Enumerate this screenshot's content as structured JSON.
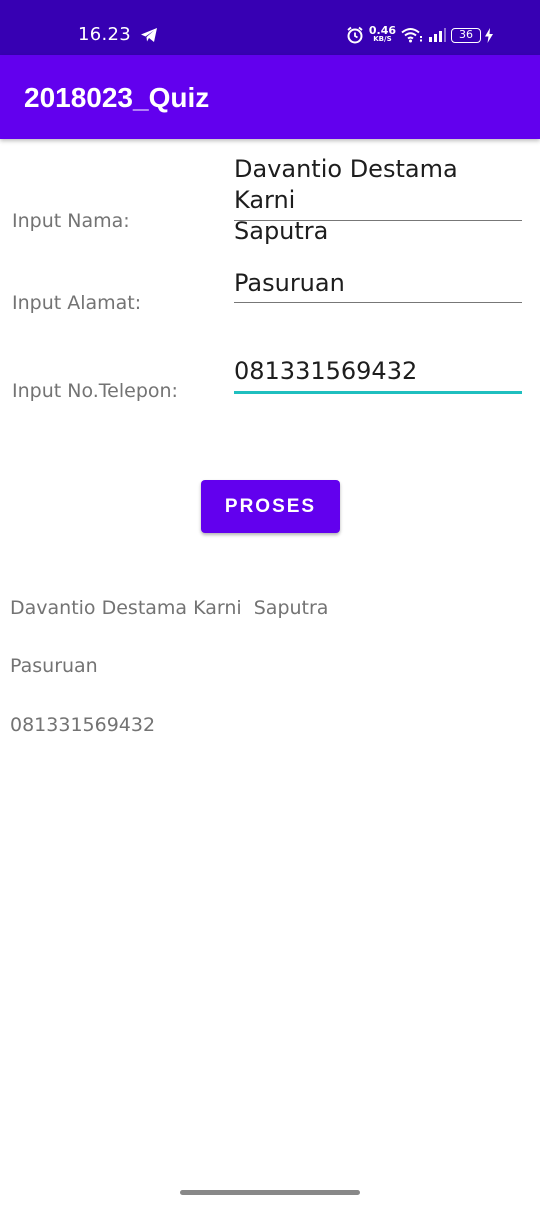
{
  "status_bar": {
    "time": "16.23",
    "speed_value": "0.46",
    "speed_unit": "KB/S",
    "battery": "36"
  },
  "app_bar": {
    "title": "2018023_Quiz"
  },
  "form": {
    "name_label": "Input Nama:",
    "name_value_line1": "Davantio Destama Karni",
    "name_value_line2": "Saputra",
    "address_label": "Input Alamat:",
    "address_value": "Pasuruan",
    "phone_label": "Input No.Telepon:",
    "phone_value": "081331569432",
    "submit_label": "PROSES"
  },
  "output": {
    "name": "Davantio Destama Karni  Saputra",
    "address": "Pasuruan",
    "phone": "081331569432"
  },
  "colors": {
    "status_bar": "#3700B3",
    "primary": "#6200EE",
    "focus_underline": "#1FBFBF"
  }
}
